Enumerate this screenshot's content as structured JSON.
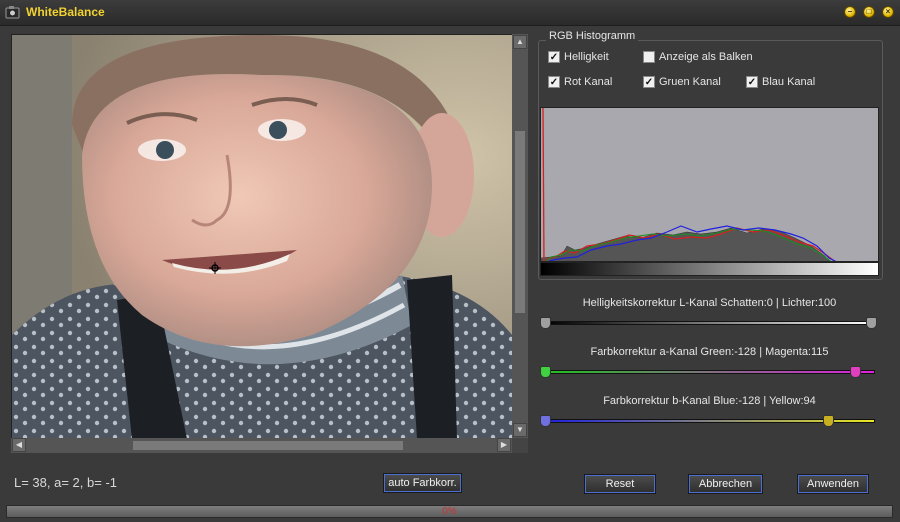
{
  "window": {
    "title": "WhiteBalance",
    "controls": [
      "minimize",
      "maximize",
      "close"
    ]
  },
  "histogram": {
    "group_title": "RGB Histogramm",
    "options": [
      {
        "label": "Helligkeit",
        "checked": true
      },
      {
        "label": "Anzeige als Balken",
        "checked": false
      },
      {
        "label": "Rot Kanal",
        "checked": true
      },
      {
        "label": "Gruen Kanal",
        "checked": true
      },
      {
        "label": "Blau Kanal",
        "checked": true
      }
    ],
    "colors": {
      "red": "#d42020",
      "green": "#1e8c1e",
      "blue": "#2020e0",
      "luma": "#555555",
      "background": "#a8a8ae"
    }
  },
  "sliders": [
    {
      "label": "Helligkeitskorrektur L-Kanal Schatten:0 | Lichter:100",
      "min": 0,
      "max": 100,
      "low": 0,
      "high": 100,
      "range": [
        0,
        100
      ],
      "gradient": [
        "#000000",
        "#ffffff"
      ],
      "handle_color": "#a0a0a0"
    },
    {
      "label": "Farbkorrektur a-Kanal Green:-128 | Magenta:115",
      "low": -128,
      "high": 115,
      "range": [
        -128,
        127
      ],
      "gradient": [
        "#20c020",
        "#e020e0"
      ],
      "handle_low_color": "#40d040",
      "handle_high_color": "#e040c0"
    },
    {
      "label": "Farbkorrektur b-Kanal Blue:-128 | Yellow:94",
      "low": -128,
      "high": 94,
      "range": [
        -128,
        127
      ],
      "gradient": [
        "#2020e0",
        "#e8e820"
      ],
      "handle_low_color": "#7070e0",
      "handle_high_color": "#c8b020"
    }
  ],
  "status": {
    "lab_readout": "L= 38, a= 2, b= -1"
  },
  "buttons": {
    "auto": "auto Farbkorr.",
    "reset": "Reset",
    "cancel": "Abbrechen",
    "apply": "Anwenden"
  },
  "progress": {
    "value": 0,
    "label": "0%"
  },
  "scroll": {
    "vertical_position": 0.24,
    "horizontal_position": 0.24
  }
}
